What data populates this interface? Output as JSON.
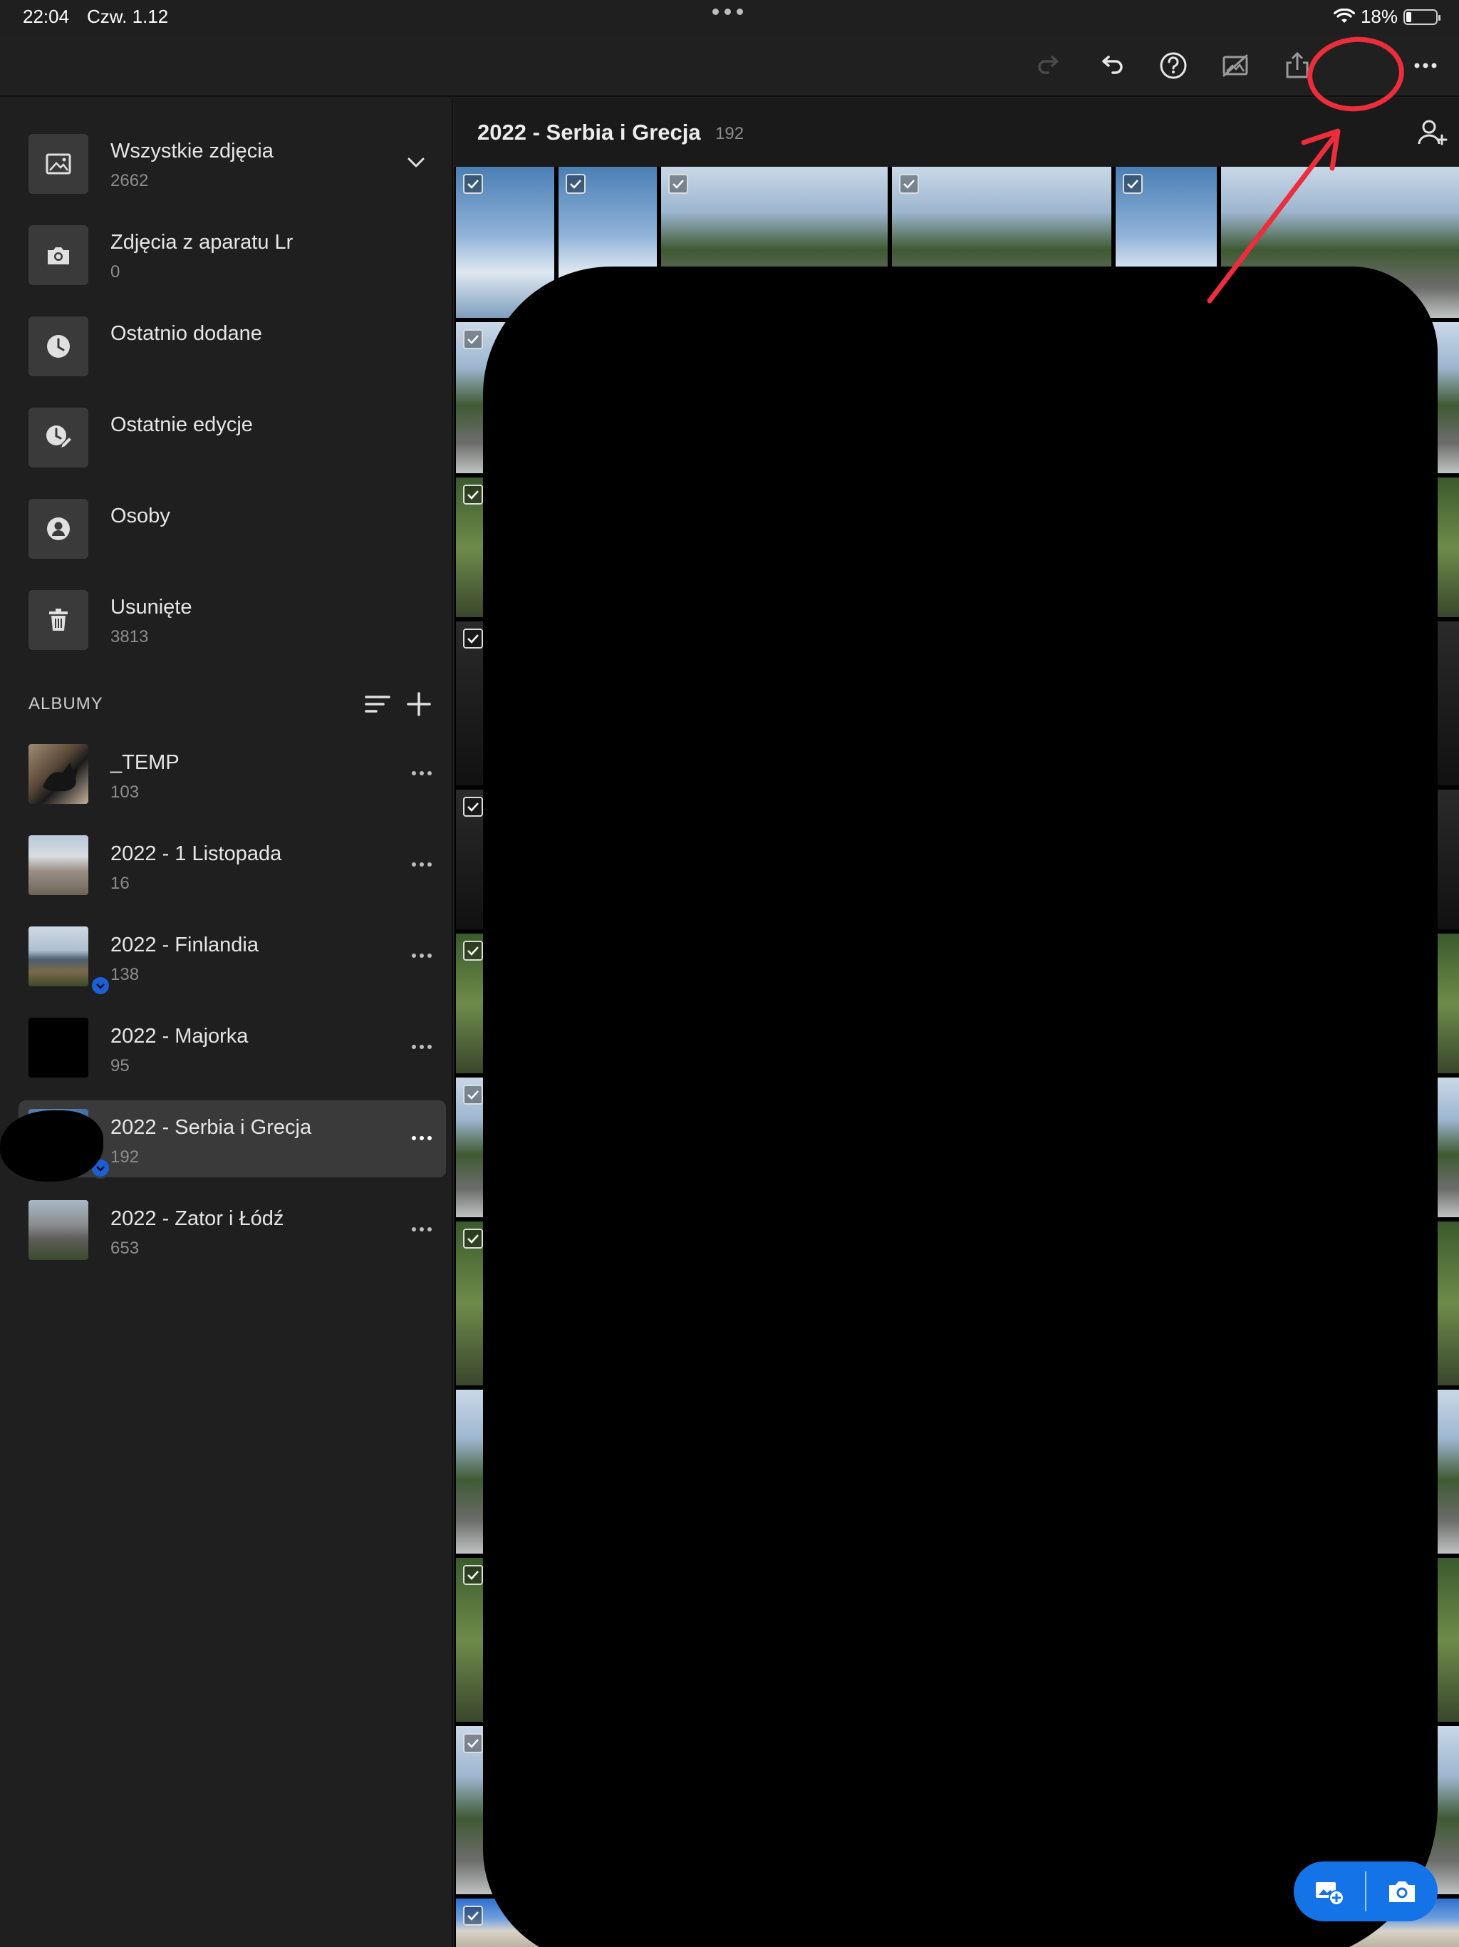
{
  "status_bar": {
    "time": "22:04",
    "date": "Czw. 1.12",
    "battery_percent": "18%",
    "battery_level": 0.18
  },
  "toolbar": {
    "icons": [
      "redo-icon",
      "undo-icon",
      "help-icon",
      "cloud-off-icon",
      "share-icon",
      "more-icon"
    ]
  },
  "sidebar": {
    "nav": [
      {
        "title": "Wszystkie zdjęcia",
        "count": "2662",
        "icon": "photos-icon"
      },
      {
        "title": "Zdjęcia z aparatu Lr",
        "count": "0",
        "icon": "camera-icon"
      },
      {
        "title": "Ostatnio dodane",
        "count": "",
        "icon": "clock-icon"
      },
      {
        "title": "Ostatnie edycje",
        "count": "",
        "icon": "edit-clock-icon"
      },
      {
        "title": "Osoby",
        "count": "",
        "icon": "person-icon"
      },
      {
        "title": "Usunięte",
        "count": "3813",
        "icon": "trash-icon"
      }
    ],
    "albums_label": "ALBUMY",
    "albums": [
      {
        "title": "_TEMP",
        "count": "103"
      },
      {
        "title": "2022 - 1 Listopada",
        "count": "16"
      },
      {
        "title": "2022 - Finlandia",
        "count": "138"
      },
      {
        "title": "2022 - Majorka",
        "count": "95"
      },
      {
        "title": "2022 - Serbia i Grecja",
        "count": "192"
      },
      {
        "title": "2022 - Zator i Łódź",
        "count": "653"
      }
    ]
  },
  "main": {
    "title": "2022 - Serbia i Grecja",
    "count": "192"
  },
  "colors": {
    "accent": "#1473e6",
    "annotation": "#ec2d3b",
    "sync_badge": "#1b5fd6"
  }
}
